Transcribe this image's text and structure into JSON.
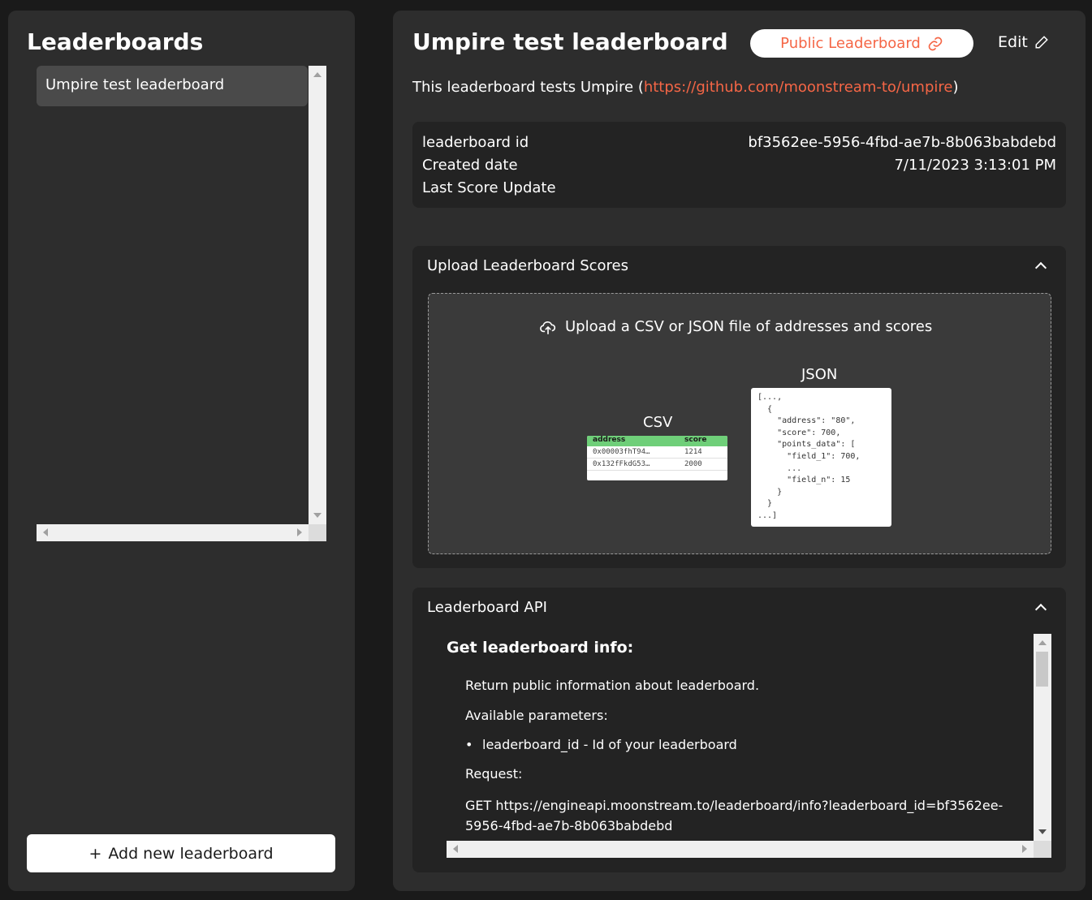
{
  "sidebar": {
    "title": "Leaderboards",
    "items": [
      {
        "label": "Umpire test leaderboard"
      }
    ],
    "add_button": {
      "icon": "+",
      "label": "Add new leaderboard"
    }
  },
  "main": {
    "title": "Umpire test leaderboard",
    "public_button": "Public Leaderboard",
    "edit_button": "Edit",
    "description_prefix": "This leaderboard tests Umpire (",
    "description_link": "https://github.com/moonstream-to/umpire",
    "description_suffix": ")",
    "info": {
      "rows": [
        {
          "label": "leaderboard id",
          "value": "bf3562ee-5956-4fbd-ae7b-8b063babdebd"
        },
        {
          "label": "Created date",
          "value": "7/11/2023 3:13:01 PM"
        },
        {
          "label": "Last Score Update",
          "value": ""
        }
      ]
    },
    "upload": {
      "header": "Upload Leaderboard Scores",
      "dropzone_text": "Upload a CSV or JSON file of addresses and scores",
      "csv_label": "CSV",
      "csv_headers": [
        "address",
        "score"
      ],
      "csv_rows": [
        [
          "0x00003fhT94…",
          "1214"
        ],
        [
          "0x132fFkdG53…",
          "2000"
        ]
      ],
      "json_label": "JSON",
      "json_sample": "[...,\n  {\n    \"address\": \"80\",\n    \"score\": 700,\n    \"points_data\": [\n      \"field_1\": 700,\n      ...\n      \"field_n\": 15\n    }\n  }\n...]"
    },
    "api": {
      "header": "Leaderboard API",
      "section_title": "Get leaderboard info:",
      "p1": "Return public information about leaderboard.",
      "p2": "Available parameters:",
      "param": "leaderboard_id - Id of your leaderboard",
      "p3": "Request:",
      "request": "GET https://engineapi.moonstream.to/leaderboard/info?leaderboard_id=bf3562ee-5956-4fbd-ae7b-8b063babdebd"
    }
  },
  "colors": {
    "accent": "#f56646",
    "panel": "#2d2d2d",
    "card": "#232323"
  }
}
